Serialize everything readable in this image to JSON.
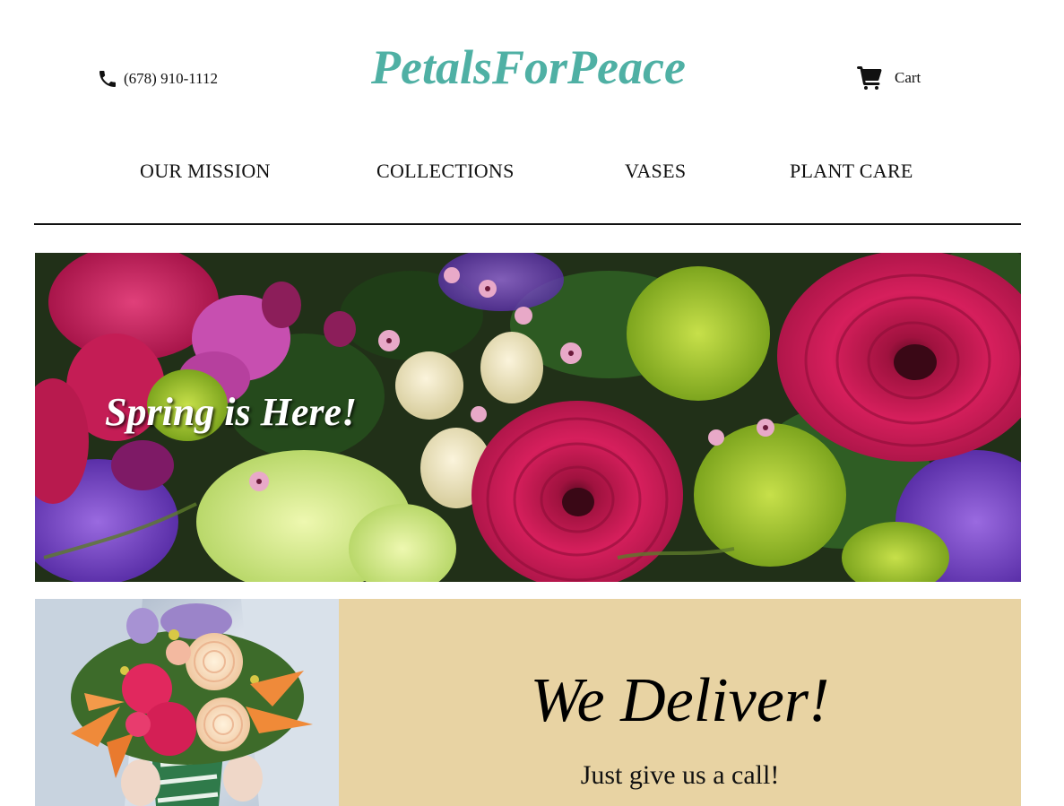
{
  "header": {
    "phone": "(678) 910-1112",
    "brand": "PetalsForPeace",
    "cart_label": "Cart",
    "brand_color": "#4fb0a4",
    "phone_icon": "phone-icon",
    "cart_icon": "shopping-cart-icon"
  },
  "nav": {
    "items": [
      {
        "label": "OUR MISSION"
      },
      {
        "label": "COLLECTIONS"
      },
      {
        "label": "VASES"
      },
      {
        "label": "PLANT CARE"
      }
    ]
  },
  "hero": {
    "title": "Spring is Here!"
  },
  "delivery": {
    "title": "We Deliver!",
    "subtitle": "Just give us a call!",
    "panel_color": "#e8d3a3"
  }
}
